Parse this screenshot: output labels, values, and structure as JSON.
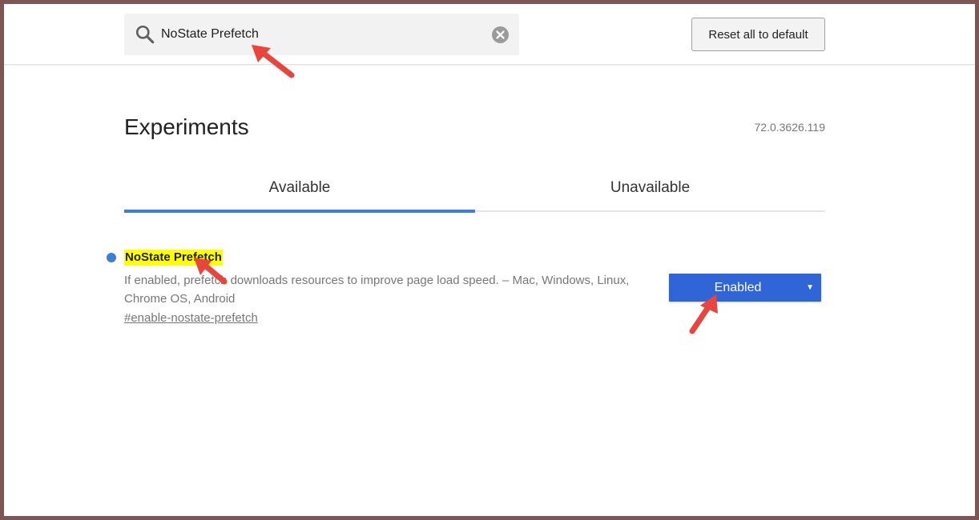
{
  "search": {
    "value": "NoState Prefetch",
    "icon": "search-icon",
    "clear_icon": "close-circle-icon"
  },
  "toolbar": {
    "reset_label": "Reset all to default"
  },
  "page": {
    "title": "Experiments",
    "version": "72.0.3626.119"
  },
  "tabs": [
    {
      "label": "Available",
      "active": true
    },
    {
      "label": "Unavailable",
      "active": false
    }
  ],
  "experiment": {
    "name": "NoState Prefetch",
    "description": "If enabled, prefetch downloads resources to improve page load speed. – Mac, Windows, Linux, Chrome OS, Android",
    "link": "#enable-nostate-prefetch",
    "selected_option": "Enabled"
  },
  "colors": {
    "accent": "#3b7fd8",
    "select_bg": "#2f65d6",
    "highlight": "#ffff00",
    "annotation_arrow": "#e8453c",
    "frame": "#7d5555"
  }
}
